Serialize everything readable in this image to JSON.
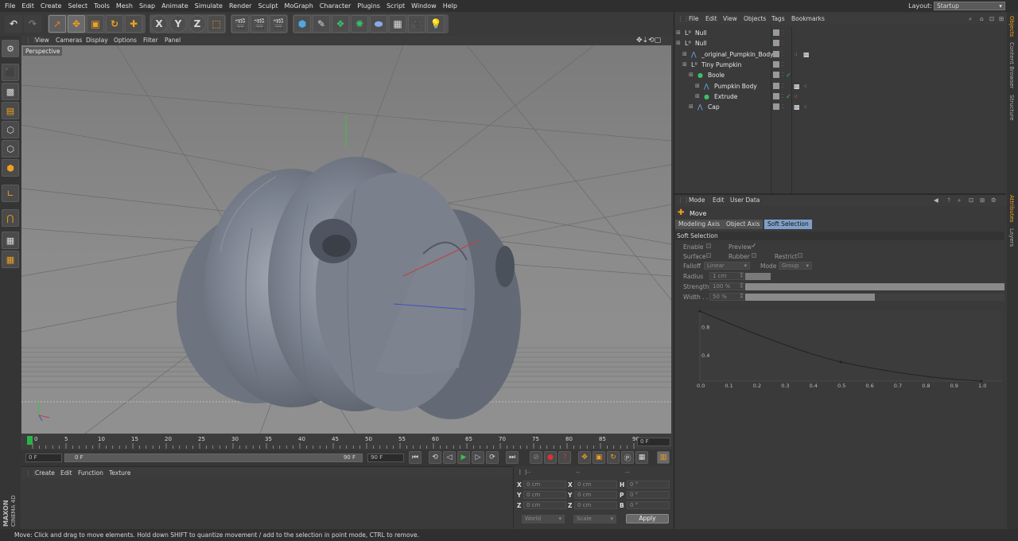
{
  "menubar": {
    "items": [
      "File",
      "Edit",
      "Create",
      "Select",
      "Tools",
      "Mesh",
      "Snap",
      "Animate",
      "Simulate",
      "Render",
      "Sculpt",
      "MoGraph",
      "Character",
      "Plugins",
      "Script",
      "Window",
      "Help"
    ],
    "layout_label": "Layout:",
    "layout_value": "Startup"
  },
  "toolbar": {
    "axis_x": "X",
    "axis_y": "Y",
    "axis_z": "Z"
  },
  "viewport": {
    "menu": [
      "View",
      "Cameras",
      "Display",
      "Options",
      "Filter",
      "Panel"
    ],
    "label": "Perspective"
  },
  "timeline": {
    "ticks": [
      "0",
      "5",
      "10",
      "15",
      "20",
      "25",
      "30",
      "35",
      "40",
      "45",
      "50",
      "55",
      "60",
      "65",
      "70",
      "75",
      "80",
      "85",
      "90"
    ],
    "current_frame": "0 F"
  },
  "transport": {
    "start_field": "0 F",
    "range_start": "0 F",
    "range_end": "90 F",
    "end_field": "90 F"
  },
  "material_manager": {
    "menu": [
      "Create",
      "Edit",
      "Function",
      "Texture"
    ]
  },
  "coordinates": {
    "header": [
      "--",
      "--",
      "--"
    ],
    "rows": [
      {
        "a": "X",
        "av": "0 cm",
        "b": "X",
        "bv": "0 cm",
        "c": "H",
        "cv": "0 °"
      },
      {
        "a": "Y",
        "av": "0 cm",
        "b": "Y",
        "bv": "0 cm",
        "c": "P",
        "cv": "0 °"
      },
      {
        "a": "Z",
        "av": "0 cm",
        "b": "Z",
        "bv": "0 cm",
        "c": "B",
        "cv": "0 °"
      }
    ],
    "world": "World",
    "scale": "Scale",
    "apply": "Apply"
  },
  "object_manager": {
    "menu": [
      "File",
      "Edit",
      "View",
      "Objects",
      "Tags",
      "Bookmarks"
    ],
    "objects": [
      {
        "name": "Null",
        "indent": 0,
        "type": "null"
      },
      {
        "name": "Null",
        "indent": 0,
        "type": "null"
      },
      {
        "name": "_original_Pumpkin_Body",
        "indent": 1,
        "type": "mesh"
      },
      {
        "name": "Tiny Pumpkin",
        "indent": 1,
        "type": "null"
      },
      {
        "name": "Boole",
        "indent": 2,
        "type": "boole"
      },
      {
        "name": "Pumpkin Body",
        "indent": 3,
        "type": "mesh"
      },
      {
        "name": "Extrude",
        "indent": 3,
        "type": "extrude"
      },
      {
        "name": "Cap",
        "indent": 2,
        "type": "mesh"
      }
    ]
  },
  "attributes": {
    "menu": [
      "Mode",
      "Edit",
      "User Data"
    ],
    "tool_name": "Move",
    "tabs": [
      "Modeling Axis",
      "Object Axis",
      "Soft Selection"
    ],
    "active_tab": "Soft Selection",
    "section": "Soft Selection",
    "enable": "Enable",
    "preview": "Preview",
    "surface": "Surface",
    "rubber": "Rubber",
    "restrict": "Restrict",
    "falloff_label": "Falloff",
    "falloff_value": "Linear",
    "mode_label": "Mode",
    "mode_value": "Group",
    "radius_label": "Radius",
    "radius_value": "1 cm",
    "strength_label": "Strength",
    "strength_value": "100 %",
    "width_label": "Width . .",
    "width_value": "50 %",
    "graph_y": [
      "0.8",
      "0.4"
    ],
    "graph_x": [
      "0.0",
      "0.1",
      "0.2",
      "0.3",
      "0.4",
      "0.5",
      "0.6",
      "0.7",
      "0.8",
      "0.9",
      "1.0"
    ]
  },
  "right_tabs": [
    "Objects",
    "Content Browser",
    "Structure",
    "Attributes",
    "Layers"
  ],
  "statusbar": "Move: Click and drag to move elements. Hold down SHIFT to quantize movement / add to the selection in point mode, CTRL to remove.",
  "brand": [
    "MAXON",
    "CINEMA 4D"
  ]
}
